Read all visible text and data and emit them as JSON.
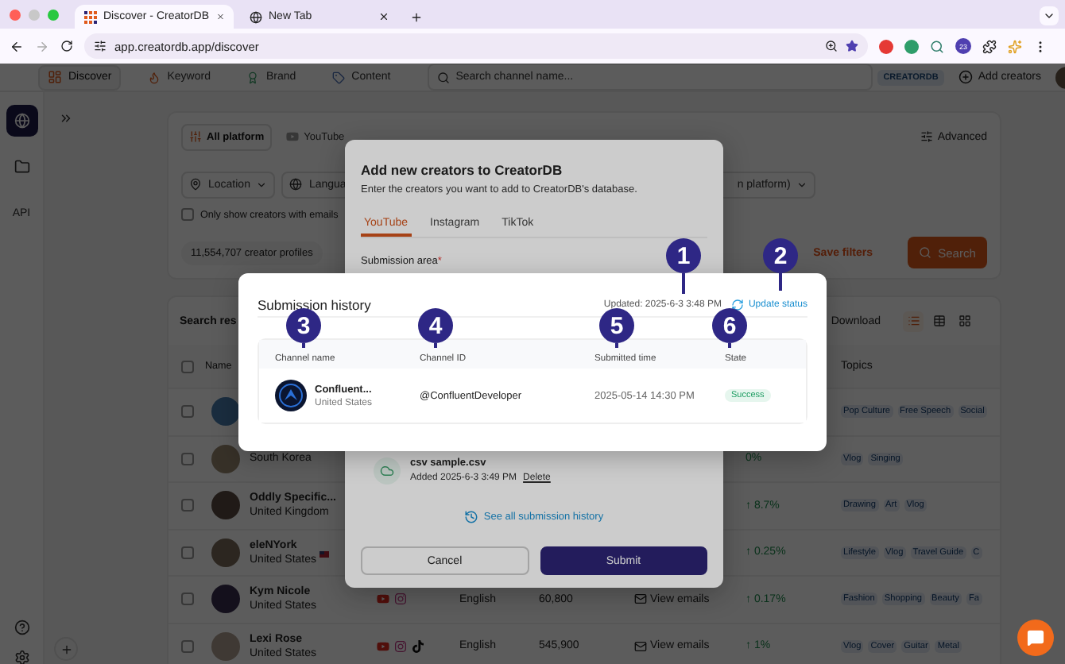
{
  "browser": {
    "tabs": [
      {
        "title": "Discover - CreatorDB",
        "selected": true
      },
      {
        "title": "New Tab",
        "selected": false
      }
    ],
    "url": "app.creatordb.app/discover",
    "extension_badge": "23"
  },
  "nav": {
    "items": [
      {
        "kind": "discover",
        "label": "Discover",
        "selected": true
      },
      {
        "kind": "keyword",
        "label": "Keyword",
        "selected": false
      },
      {
        "kind": "brand",
        "label": "Brand",
        "selected": false
      },
      {
        "kind": "content",
        "label": "Content",
        "selected": false
      }
    ],
    "search_placeholder": "Search channel name...",
    "badge": "CREATORDB",
    "add_button": "Add creators"
  },
  "sidebar": {
    "items": [
      {
        "kind": "globe",
        "selected": true
      },
      {
        "kind": "folder",
        "selected": false
      },
      {
        "kind": "text",
        "label": "API",
        "selected": false
      }
    ]
  },
  "filters": {
    "platform_tabs": [
      {
        "kind": "all",
        "label": "All platform",
        "selected": true
      },
      {
        "kind": "youtube",
        "label": "YouTube",
        "selected": false
      }
    ],
    "advanced": "Advanced",
    "location": "Location",
    "language": "Langua",
    "platform_dropdown": "n platform)",
    "emails_only": {
      "label": "Only show creators with emails",
      "checked": false
    },
    "profile_count": "11,554,707 creator profiles",
    "save_filters": "Save filters",
    "search_button": "Search"
  },
  "results": {
    "title": "Search res",
    "download": "Download",
    "views": [
      {
        "kind": "list",
        "selected": true
      },
      {
        "kind": "table",
        "selected": false
      },
      {
        "kind": "grid",
        "selected": false
      }
    ],
    "header_checked": false,
    "columns": {
      "name": "Name",
      "topics": "Topics"
    },
    "rows": [
      {
        "checked": false,
        "topics": [
          "Pop Culture",
          "Free Speech",
          "Social"
        ]
      },
      {
        "checked": false,
        "country": "South Korea",
        "growth": "0%",
        "topics": [
          "Vlog",
          "Singing"
        ]
      },
      {
        "checked": false,
        "name": "Oddly Specific...",
        "country": "United Kingdom",
        "growth": "↑ 8.7%",
        "topics": [
          "Drawing",
          "Art",
          "Vlog"
        ]
      },
      {
        "checked": false,
        "name": "eleNYork",
        "flag": true,
        "country": "United States",
        "growth": "↑ 0.25%",
        "topics": [
          "Lifestyle",
          "Vlog",
          "Travel Guide",
          "C"
        ]
      },
      {
        "checked": false,
        "name": "Kym Nicole",
        "country": "United States",
        "platforms": [
          {
            "kind": "youtube"
          },
          {
            "kind": "instagram"
          }
        ],
        "language": "English",
        "followers": "60,800",
        "emails": "View emails",
        "growth": "↑ 0.17%",
        "topics": [
          "Fashion",
          "Shopping",
          "Beauty",
          "Fa"
        ]
      },
      {
        "checked": false,
        "name": "Lexi Rose",
        "country": "United States",
        "platforms": [
          {
            "kind": "youtube"
          },
          {
            "kind": "instagram"
          },
          {
            "kind": "tiktok"
          }
        ],
        "language": "English",
        "followers": "545,900",
        "emails": "View emails",
        "growth": "↑ 1%",
        "topics": [
          "Vlog",
          "Cover",
          "Guitar",
          "Metal"
        ]
      }
    ]
  },
  "add_dialog": {
    "title": "Add new creators to CreatorDB",
    "description": "Enter the creators you want to add to CreatorDB's database.",
    "tabs": [
      {
        "label": "YouTube",
        "selected": true
      },
      {
        "label": "Instagram",
        "selected": false
      },
      {
        "label": "TikTok",
        "selected": false
      }
    ],
    "field_label": "Submission area",
    "required_mark": "*",
    "file": {
      "name": "csv sample.csv",
      "added": "Added 2025-6-3 3:49 PM",
      "delete": "Delete"
    },
    "history_link": "See all submission history",
    "cancel": "Cancel",
    "submit": "Submit"
  },
  "history_dialog": {
    "title": "Submission history",
    "updated": "Updated: 2025-6-3 3:48 PM",
    "update_link": "Update status",
    "columns": [
      "Channel name",
      "Channel ID",
      "Submitted time",
      "State"
    ],
    "rows": [
      {
        "name": "Confluent...",
        "country": "United States",
        "channel_id": "@ConfluentDeveloper",
        "submitted": "2025-05-14 14:30 PM",
        "state": "Success",
        "kind": "success"
      }
    ]
  },
  "callouts": [
    {
      "label": "1"
    },
    {
      "label": "2"
    },
    {
      "label": "3"
    },
    {
      "label": "4"
    },
    {
      "label": "5"
    },
    {
      "label": "6"
    }
  ]
}
